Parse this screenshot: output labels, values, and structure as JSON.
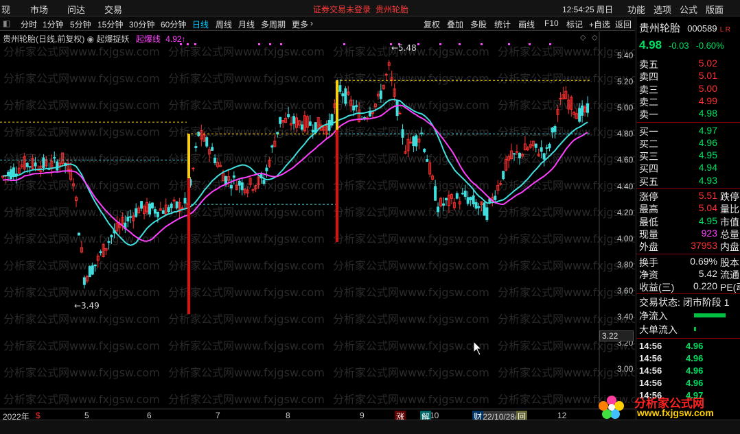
{
  "topbar": {
    "menus": [
      "现",
      "市场",
      "问达",
      "交易"
    ],
    "alert": "证券交易未登录",
    "alert_stock": "贵州轮胎",
    "clock": "12:54:25 周日",
    "right_menus": [
      "功能",
      "选项",
      "公式",
      "版面"
    ]
  },
  "periods": [
    "分时",
    "1分钟",
    "5分钟",
    "15分钟",
    "30分钟",
    "60分钟",
    "日线",
    "周线",
    "月线",
    "多周期",
    "更多"
  ],
  "tools": [
    "复权",
    "叠加",
    "多股",
    "统计",
    "画线",
    "F10",
    "标记",
    "+自选",
    "返回"
  ],
  "legend": {
    "stock": "贵州轮胎(日线,前复权)",
    "indicator_name": "起爆捉妖",
    "indicator_label": "起爆线",
    "indicator_value": "4.92"
  },
  "chart_data": {
    "type": "candlestick",
    "y_ticks": [
      "5.40",
      "5.20",
      "5.00",
      "4.80",
      "4.60",
      "4.40",
      "4.20",
      "4.00",
      "3.80",
      "3.60",
      "3.40",
      "3.20",
      "3.00"
    ],
    "x_ticks": [
      "2022年",
      "5",
      "6",
      "7",
      "8",
      "9",
      "10",
      "2022/10/28/五",
      "12"
    ],
    "annotations": [
      {
        "text": "5.48"
      },
      {
        "text": "3.49"
      }
    ],
    "current_price": "3.22",
    "flags": [
      "$",
      "涨",
      "解",
      "财",
      "回"
    ]
  },
  "quote": {
    "name": "贵州轮胎",
    "code": "000589",
    "code_tag": "L R",
    "price": "4.98",
    "change": "-0.03",
    "pct": "-0.60%",
    "asks": [
      {
        "label": "卖五",
        "price": "5.02"
      },
      {
        "label": "卖四",
        "price": "5.01"
      },
      {
        "label": "卖三",
        "price": "5.00"
      },
      {
        "label": "卖二",
        "price": "4.99"
      },
      {
        "label": "卖一",
        "price": "4.98"
      }
    ],
    "bids": [
      {
        "label": "买一",
        "price": "4.97"
      },
      {
        "label": "买二",
        "price": "4.96"
      },
      {
        "label": "买三",
        "price": "4.95"
      },
      {
        "label": "买四",
        "price": "4.94"
      },
      {
        "label": "买五",
        "price": "4.93"
      }
    ],
    "stats": [
      {
        "label": "涨停",
        "value": "5.51",
        "right": "跌停"
      },
      {
        "label": "最高",
        "value": "5.04",
        "right": "量比"
      },
      {
        "label": "最低",
        "value": "4.95",
        "right": "市值"
      },
      {
        "label": "现量",
        "value": "923",
        "right": "总量"
      },
      {
        "label": "外盘",
        "value": "37953",
        "right": "内盘"
      }
    ],
    "fund": [
      {
        "label": "换手",
        "value": "0.69%",
        "right": "股本"
      },
      {
        "label": "净资",
        "value": "5.42",
        "right": "流通"
      },
      {
        "label": "收益(三)",
        "value": "0.220",
        "right": "PE(动"
      }
    ],
    "state": "交易状态: 闭市阶段 1",
    "net_in": "净流入",
    "big_in": "大单流入",
    "ticks": [
      {
        "t": "14:56",
        "p": "4.96"
      },
      {
        "t": "14:56",
        "p": "4.96"
      },
      {
        "t": "14:56",
        "p": "4.96"
      },
      {
        "t": "14:56",
        "p": "4.96"
      },
      {
        "t": "14:56",
        "p": "4.97"
      }
    ]
  },
  "logo": {
    "title": "分析家公式网",
    "url": "www.fxjgsw.com"
  },
  "watermark": "分析家公式网www.fxjgsw.com"
}
